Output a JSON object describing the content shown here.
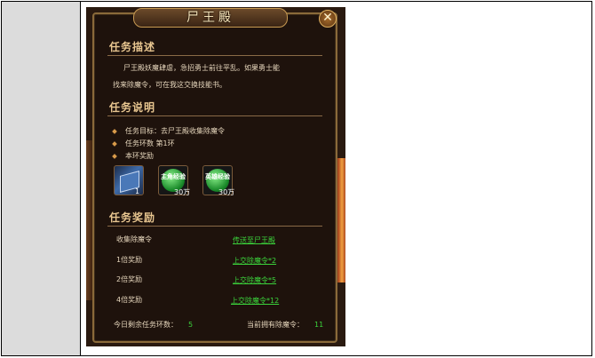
{
  "dialog": {
    "title": "尸王殿",
    "close_glyph": "✕"
  },
  "description": {
    "heading": "任务描述",
    "line1": "尸王殿妖魔肆虐，急招勇士前往平乱。如果勇士能",
    "line2": "找来除魔令，可在我这交换技能书。"
  },
  "explanation": {
    "heading": "任务说明",
    "items": [
      "任务目标：去尸王殿收集除魔令",
      "任务环数   第1环",
      "本环奖励"
    ]
  },
  "reward_icons": [
    {
      "icon": "skill-book-icon",
      "label": "",
      "count": "1"
    },
    {
      "icon": "hero-exp-orb-icon",
      "label": "主角经验",
      "count": "30万"
    },
    {
      "icon": "heroic-exp-orb-icon",
      "label": "英雄经验",
      "count": "30万"
    }
  ],
  "rewards": {
    "heading": "任务奖励",
    "rows": [
      {
        "label": "收集除魔令",
        "action": "传送至尸王殿"
      },
      {
        "label": "1倍奖励",
        "action": "上交除魔令*2"
      },
      {
        "label": "2倍奖励",
        "action": "上交除魔令*5"
      },
      {
        "label": "4倍奖励",
        "action": "上交除魔令*12"
      }
    ]
  },
  "footer": {
    "remaining_label": "今日剩余任务环数：",
    "remaining_value": "5",
    "owned_label": "当前拥有除魔令：",
    "owned_value": "11"
  },
  "colors": {
    "link": "#3bd33b",
    "heading": "#e8c690",
    "panel": "#1e120c"
  }
}
